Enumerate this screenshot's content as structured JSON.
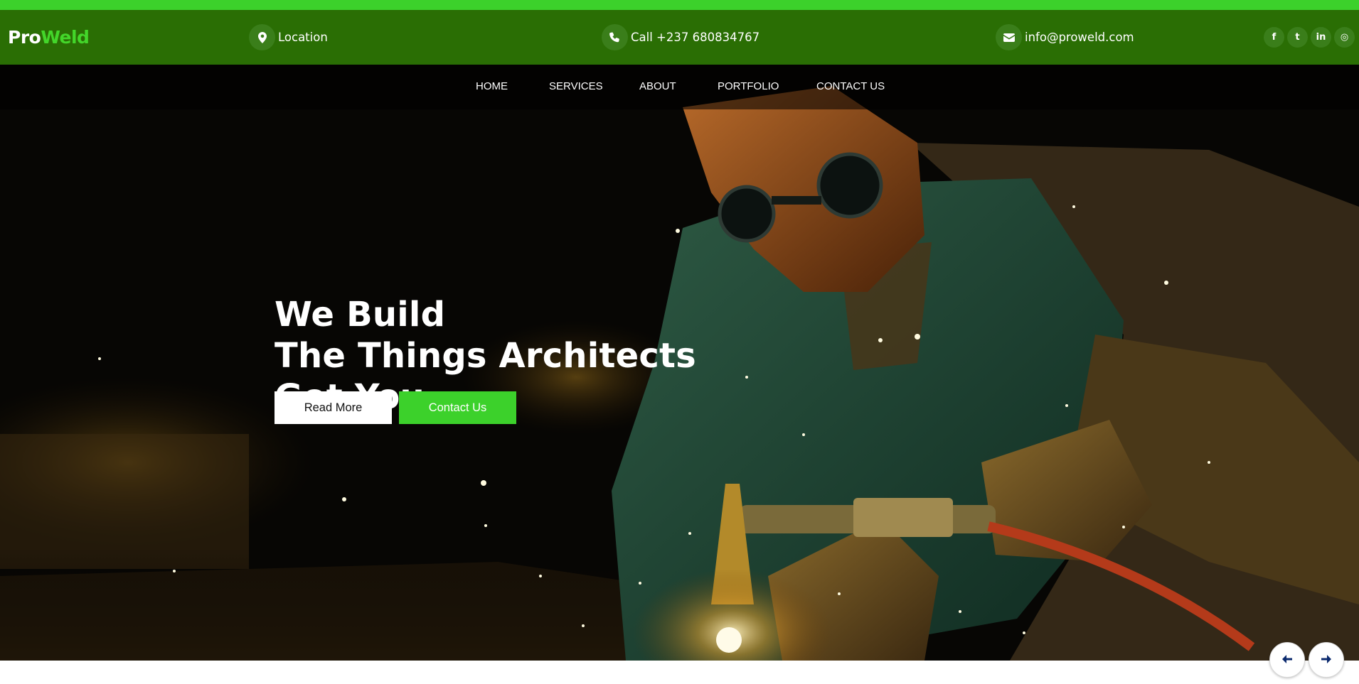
{
  "brand": {
    "part1": "Pro",
    "part2": "Weld"
  },
  "topbar": {
    "location": {
      "icon": "map-marker-icon",
      "text": "Location"
    },
    "phone": {
      "icon": "phone-icon",
      "text": "Call +237 680834767"
    },
    "email": {
      "icon": "envelope-icon",
      "text": "info@proweld.com"
    },
    "social": [
      {
        "name": "facebook-icon",
        "glyph": "f"
      },
      {
        "name": "twitter-icon",
        "glyph": "t"
      },
      {
        "name": "linkedin-icon",
        "glyph": "in"
      },
      {
        "name": "instagram-icon",
        "glyph": "◎"
      }
    ]
  },
  "nav": {
    "items": [
      "HOME",
      "SERVICES",
      "ABOUT",
      "PORTFOLIO",
      "CONTACT US"
    ]
  },
  "hero": {
    "heading": [
      "We Build",
      "The Things Architects",
      "Got You"
    ],
    "read_more_label": "Read More",
    "contact_label": "Contact Us"
  },
  "slider": {
    "prev_icon": "arrow-left-icon",
    "next_icon": "arrow-right-icon"
  },
  "colors": {
    "strip": "#3cd12b",
    "topbar": "#2a6e04",
    "accent": "#3cd12b",
    "arrow": "#0b2a6e"
  }
}
